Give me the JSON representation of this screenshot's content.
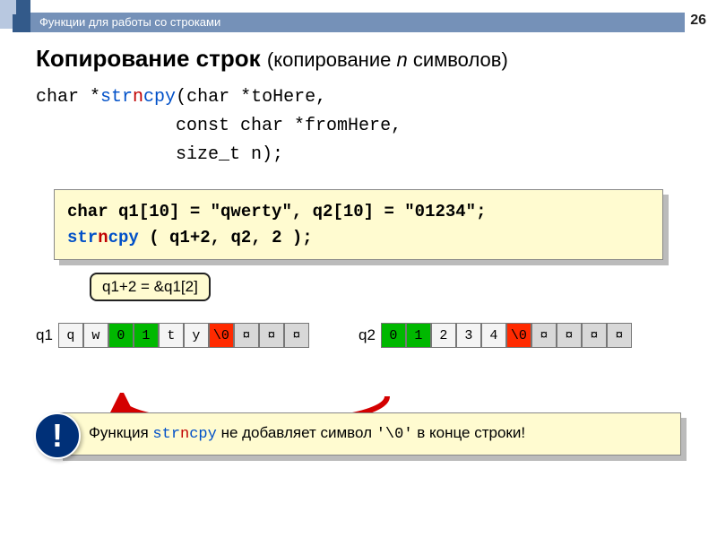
{
  "header": {
    "title": "Функции для работы со строками",
    "page": "26"
  },
  "heading": {
    "main": "Копирование строк",
    "sub_open": "(копирование ",
    "sub_n": "n",
    "sub_close": " символов)"
  },
  "signature": {
    "ret": "char *",
    "fn_pre": "str",
    "fn_red": "n",
    "fn_post": "cpy",
    "line1_rest": "(char *toHere,",
    "line2": "             const char *fromHere,",
    "line3": "             size_t n);"
  },
  "codebox": {
    "l1a": "char q1[10] = \"qwerty\",  q2[10] = \"01234\";",
    "l2_fn_pre": "str",
    "l2_fn_red": "n",
    "l2_fn_post": "cpy",
    "l2_rest": " ( q1+2, q2, 2 );"
  },
  "bubble": "q1+2 = &q1[2]",
  "arrays": {
    "q1_label": "q1",
    "q1_cells": [
      "q",
      "w",
      "0",
      "1",
      "t",
      "y",
      "\\0",
      "¤",
      "¤",
      "¤"
    ],
    "q2_label": "q2",
    "q2_cells": [
      "0",
      "1",
      "2",
      "3",
      "4",
      "\\0",
      "¤",
      "¤",
      "¤",
      "¤"
    ]
  },
  "note": {
    "excl": "!",
    "t1": "Функция ",
    "fn_pre": "str",
    "fn_red": "n",
    "fn_post": "cpy",
    "t2": " не добавляет символ ",
    "nul": "'\\0'",
    "t3": " в конце строки!"
  }
}
